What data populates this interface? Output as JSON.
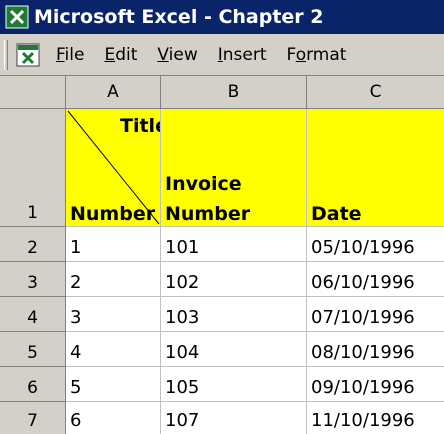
{
  "window": {
    "title": "Microsoft Excel - Chapter 2"
  },
  "menu": [
    {
      "label": "File",
      "u": "F",
      "rest": "ile"
    },
    {
      "label": "Edit",
      "u": "E",
      "rest": "dit"
    },
    {
      "label": "View",
      "u": "V",
      "rest": "iew"
    },
    {
      "label": "Insert",
      "u": "I",
      "rest": "nsert"
    },
    {
      "label": "Format",
      "u": "o",
      "pre": "F",
      "rest": "rmat"
    }
  ],
  "columns": [
    "A",
    "B",
    "C"
  ],
  "header_row": {
    "row_number": "1",
    "a_top": "Title",
    "a_bottom": "Number",
    "b_line1": "Invoice",
    "b_line2": "Number",
    "c": "Date"
  },
  "rows": [
    {
      "n": "2",
      "a": "1",
      "b": "101",
      "c": "05/10/1996"
    },
    {
      "n": "3",
      "a": "2",
      "b": "102",
      "c": "06/10/1996"
    },
    {
      "n": "4",
      "a": "3",
      "b": "103",
      "c": "07/10/1996"
    },
    {
      "n": "5",
      "a": "4",
      "b": "104",
      "c": "08/10/1996"
    },
    {
      "n": "6",
      "a": "5",
      "b": "105",
      "c": "09/10/1996"
    },
    {
      "n": "7",
      "a": "6",
      "b": "107",
      "c": "11/10/1996"
    }
  ],
  "colors": {
    "titlebar": "#0a246a",
    "header_fill": "#ffff00",
    "chrome": "#d4d0c8"
  }
}
